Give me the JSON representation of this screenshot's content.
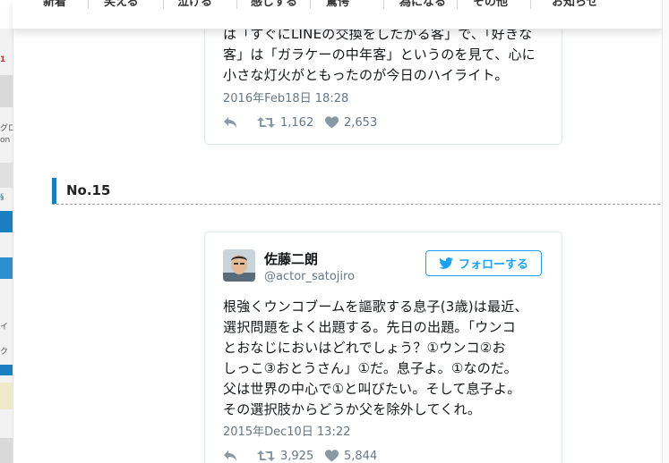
{
  "nav": {
    "items": [
      "新着",
      "笑える",
      "泣ける",
      "感じする",
      "驚愕",
      "為になる",
      "その他",
      "お知らせ"
    ]
  },
  "background_fragments": [
    "1",
    "グロ",
    "on",
    "§",
    "イ",
    "ク"
  ],
  "tweet1": {
    "text_lines": [
      "は「すぐにLINEの交換をしたがる客」で、「好きな",
      "客」は「ガラケーの中年客」というのを見て、心に",
      "小さな灯火がともったのが今日のハイライト。"
    ],
    "date": "2016年Feb18日 18:28",
    "retweets": "1,162",
    "likes": "2,653"
  },
  "section": {
    "label": "No.15"
  },
  "tweet2": {
    "author_name": "佐藤二朗",
    "author_handle": "@actor_satojiro",
    "follow_label": "フォローする",
    "text_lines": [
      "根強くウンコブームを謳歌する息子(3歳)は最近、",
      "選択問題をよく出題する。先日の出題。「ウンコ",
      "とおなじにおいはどれでしょう？①ウンコ②お",
      "しっこ③おとうさん」①だ。息子よ。①なのだ。",
      "父は世界の中心で①と叫びたい。そして息子よ。",
      "その選択肢からどうか父を除外してくれ。"
    ],
    "date": "2015年Dec10日 13:22",
    "retweets": "3,925",
    "likes": "5,844"
  },
  "colors": {
    "accent": "#1a7ec2",
    "twitter_blue": "#1da1f2",
    "meta_gray": "#657786"
  },
  "icons": {
    "reply": "reply-icon",
    "retweet": "retweet-icon",
    "like": "heart-icon",
    "twitter": "twitter-bird-icon"
  }
}
